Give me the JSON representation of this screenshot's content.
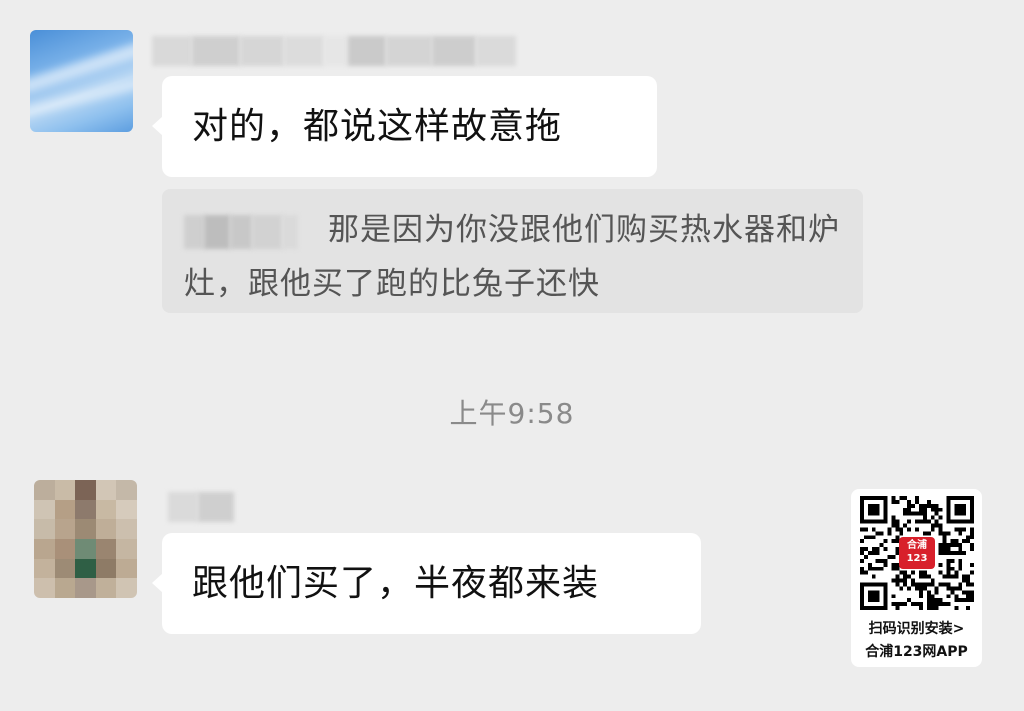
{
  "messages": [
    {
      "text": "对的，都说这样故意拖"
    },
    {
      "quote_text": "那是因为你没跟他们购买热水器和炉灶，跟他买了跑的比兔子还快"
    },
    {
      "text": "跟他们买了，半夜都来装"
    }
  ],
  "timestamp": "上午9:58",
  "watermark": {
    "badge_text": "合浦123",
    "caption_line1": "扫码识别安装>",
    "caption_line2": "合浦123网APP"
  },
  "colors": {
    "background": "#ededed",
    "bubble": "#ffffff",
    "quote_bg": "#e3e3e3",
    "timestamp": "#8a8a8a",
    "badge": "#d8202b"
  }
}
